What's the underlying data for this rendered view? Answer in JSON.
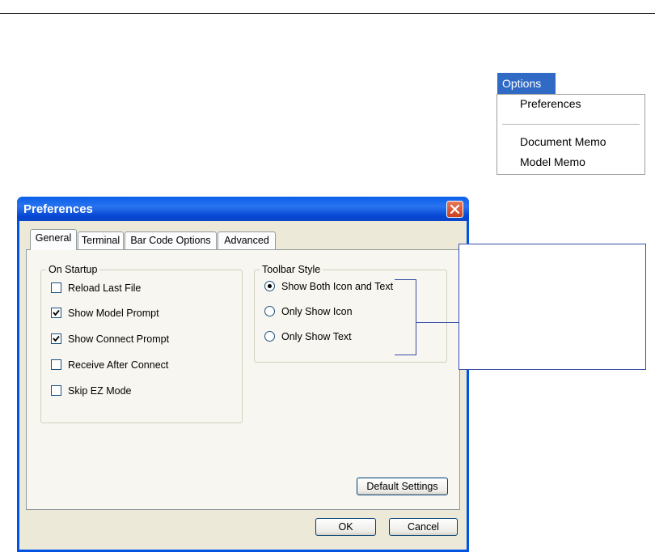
{
  "menu": {
    "title": "Options",
    "items": [
      "Preferences",
      "Document Memo",
      "Model Memo"
    ]
  },
  "dialog": {
    "title": "Preferences",
    "tabs": [
      "General",
      "Terminal",
      "Bar Code Options",
      "Advanced"
    ],
    "startup": {
      "label": "On Startup",
      "options": [
        {
          "label": "Reload Last File",
          "checked": false
        },
        {
          "label": "Show Model Prompt",
          "checked": true
        },
        {
          "label": "Show Connect Prompt",
          "checked": true
        },
        {
          "label": "Receive After Connect",
          "checked": false
        },
        {
          "label": "Skip EZ Mode",
          "checked": false
        }
      ]
    },
    "toolbar": {
      "label": "Toolbar Style",
      "options": [
        {
          "label": "Show Both Icon and Text",
          "selected": true
        },
        {
          "label": "Only Show Icon",
          "selected": false
        },
        {
          "label": "Only Show Text",
          "selected": false
        }
      ]
    },
    "buttons": {
      "default_settings": "Default Settings",
      "ok": "OK",
      "cancel": "Cancel"
    }
  },
  "colors": {
    "titlebar": "#0054e3",
    "menu_highlight": "#316ac5",
    "callout_line": "#3b4ea8"
  }
}
